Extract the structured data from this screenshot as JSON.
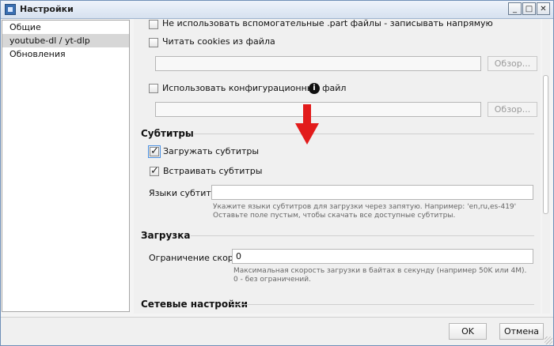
{
  "window": {
    "title": "Настройки",
    "controls": {
      "minimize": "_",
      "maximize": "□",
      "close": "✕"
    }
  },
  "sidebar": {
    "items": [
      {
        "label": "Общие",
        "selected": false
      },
      {
        "label": "youtube-dl / yt-dlp",
        "selected": true
      },
      {
        "label": "Обновления",
        "selected": false
      }
    ]
  },
  "options": {
    "partial_option": "Не использовать вспомогательные .part файлы - записывать напрямую",
    "cookies_option": "Читать cookies из файла",
    "cookies_browse": "Обзор...",
    "config_option": "Использовать конфигурационный файл",
    "config_browse": "Обзор..."
  },
  "subtitles": {
    "section_title": "Субтитры",
    "download_label": "Загружать субтитры",
    "download_checked": true,
    "embed_label": "Встраивать субтитры",
    "embed_checked": true,
    "languages_label": "Языки субтитров",
    "languages_value": "",
    "hint_line1": "Укажите языки субтитров для загрузки через запятую. Например: 'en,ru,es-419'",
    "hint_line2": "Оставьте поле пустым, чтобы скачать все доступные субтитры."
  },
  "download": {
    "section_title": "Загрузка",
    "speed_limit_label": "Ограничение скорости",
    "speed_limit_value": "0",
    "hint_line1": "Максимальная скорость загрузки в байтах в секунду (например 50K или 4M).",
    "hint_line2": "0 - без ограничений."
  },
  "network": {
    "section_title": "Сетевые настройки"
  },
  "footer": {
    "ok_label": "OK",
    "cancel_label": "Отмена"
  },
  "icons": {
    "info": "i"
  },
  "colors": {
    "annotation_arrow": "#e21b1b",
    "focus": "#4a90e2",
    "selected_sidebar": "#d7d7d7"
  }
}
